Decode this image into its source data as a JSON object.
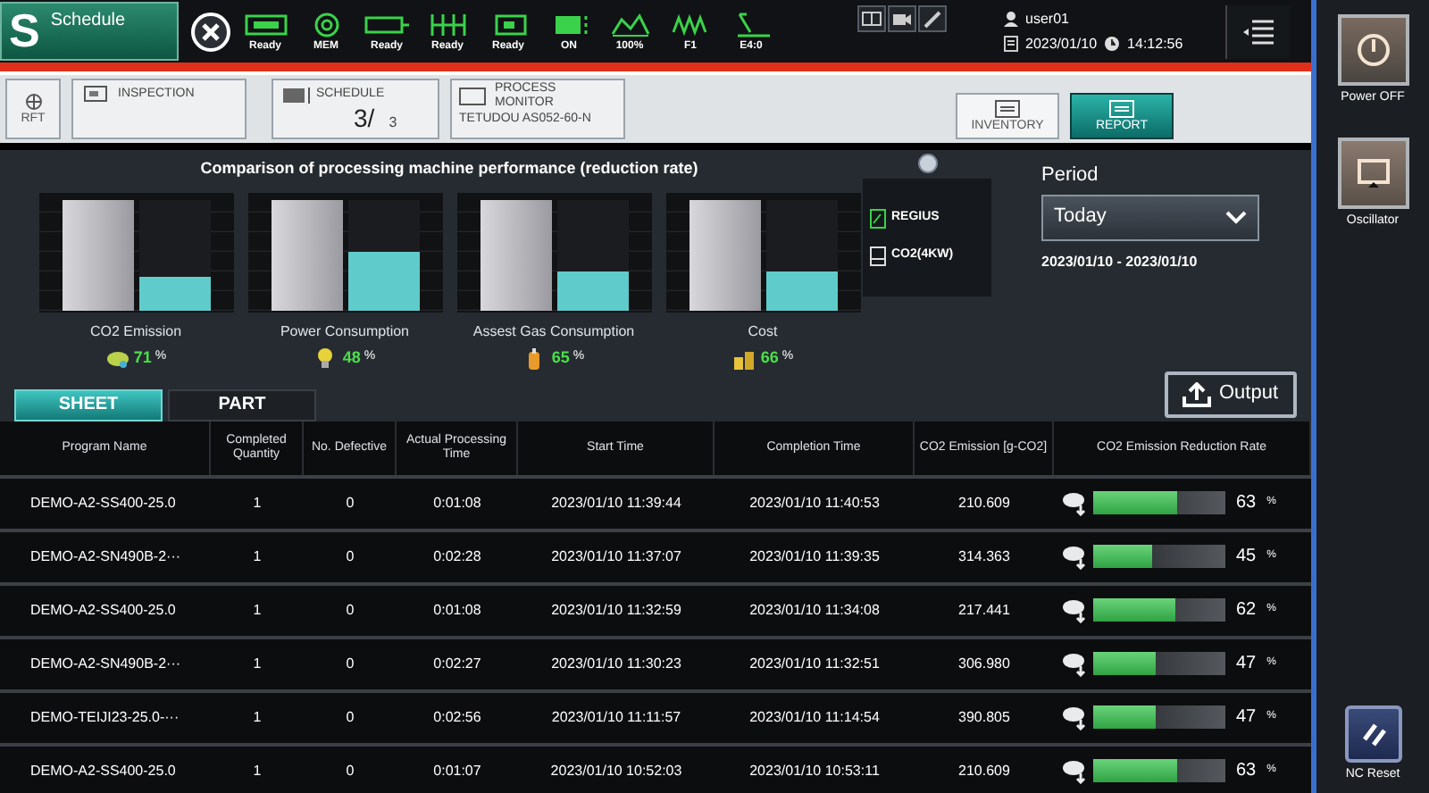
{
  "logo": {
    "letter": "S",
    "title": "Schedule"
  },
  "status_items": [
    {
      "label": "Ready"
    },
    {
      "label": "MEM"
    },
    {
      "label": "Ready"
    },
    {
      "label": "Ready"
    },
    {
      "label": "Ready"
    },
    {
      "label": "ON"
    },
    {
      "label": "100%"
    },
    {
      "label": "F1"
    },
    {
      "label": "E4:0"
    }
  ],
  "user": "user01",
  "date": "2023/01/10",
  "time": "14:12:56",
  "nav": [
    {
      "kind": "icon",
      "label": "RFT"
    },
    {
      "kind": "panel",
      "label": "INSPECTION"
    },
    {
      "kind": "counter",
      "label": "SCHEDULE",
      "value": "3/",
      "total": "3"
    },
    {
      "kind": "monitor",
      "label": "PROCESS MONITOR",
      "detail": "TETUDOU AS052-60-N"
    }
  ],
  "view_tabs": [
    {
      "label": "INVENTORY",
      "selected": false
    },
    {
      "label": "REPORT",
      "selected": true
    }
  ],
  "comparison": {
    "title": "Comparison of processing machine performance (reduction rate)",
    "metrics": [
      {
        "name": "CO2 Emission",
        "value": "71",
        "unit": "%",
        "level": 0.3
      },
      {
        "name": "Power Consumption",
        "value": "48",
        "unit": "%",
        "level": 0.52
      },
      {
        "name": "Assest Gas Consumption",
        "value": "65",
        "unit": "%",
        "level": 0.35
      },
      {
        "name": "Cost",
        "value": "66",
        "unit": "%",
        "level": 0.34
      }
    ],
    "legend": [
      "REGIUS",
      "CO2(4KW)"
    ]
  },
  "period": {
    "label": "Period",
    "value": "Today",
    "range": "2023/01/10 - 2023/01/10"
  },
  "tabs": [
    {
      "label": "SHEET",
      "selected": true
    },
    {
      "label": "PART",
      "selected": false
    }
  ],
  "output_button": "Output",
  "table": {
    "columns": [
      "Program Name",
      "Completed Quantity",
      "No. Defective",
      "Actual Processing Time",
      "Start Time",
      "Completion Time",
      "CO2 Emission [g-CO2]",
      "CO2 Emission Reduction Rate"
    ],
    "rows": [
      {
        "cells": [
          "DEMO-A2-SS400-25.0",
          "1",
          "0",
          "0:01:08",
          "2023/01/10 11:39:44",
          "2023/01/10 11:40:53",
          "210.609"
        ],
        "level": 0.63,
        "reading": "63",
        "unit": "%"
      },
      {
        "cells": [
          "DEMO-A2-SN490B-2···",
          "1",
          "0",
          "0:02:28",
          "2023/01/10 11:37:07",
          "2023/01/10 11:39:35",
          "314.363"
        ],
        "level": 0.45,
        "reading": "45",
        "unit": "%"
      },
      {
        "cells": [
          "DEMO-A2-SS400-25.0",
          "1",
          "0",
          "0:01:08",
          "2023/01/10 11:32:59",
          "2023/01/10 11:34:08",
          "217.441"
        ],
        "level": 0.62,
        "reading": "62",
        "unit": "%"
      },
      {
        "cells": [
          "DEMO-A2-SN490B-2···",
          "1",
          "0",
          "0:02:27",
          "2023/01/10 11:30:23",
          "2023/01/10 11:32:51",
          "306.980"
        ],
        "level": 0.47,
        "reading": "47",
        "unit": "%"
      },
      {
        "cells": [
          "DEMO-TEIJI23-25.0-···",
          "1",
          "0",
          "0:02:56",
          "2023/01/10 11:11:57",
          "2023/01/10 11:14:54",
          "390.805"
        ],
        "level": 0.47,
        "reading": "47",
        "unit": "%"
      },
      {
        "cells": [
          "DEMO-A2-SS400-25.0",
          "1",
          "0",
          "0:01:07",
          "2023/01/10 10:52:03",
          "2023/01/10 10:53:11",
          "210.609"
        ],
        "level": 0.63,
        "reading": "63",
        "unit": "%"
      }
    ]
  },
  "side_buttons": [
    {
      "kind": "power",
      "label": "Power OFF"
    },
    {
      "kind": "oscillator",
      "label": "Oscillator"
    },
    {
      "kind": "reset",
      "label": "NC Reset"
    }
  ]
}
